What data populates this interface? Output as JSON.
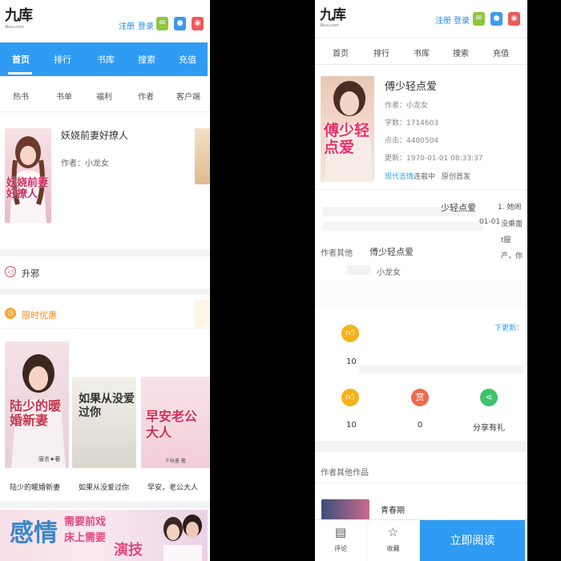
{
  "left": {
    "logo_main": "九库",
    "logo_sub": "9kus.com",
    "header_links": {
      "register": "注册",
      "login": "登录"
    },
    "nav": [
      "首页",
      "排行",
      "书库",
      "搜索",
      "充值"
    ],
    "subnav": [
      "热书",
      "书单",
      "福利",
      "作者",
      "客户端"
    ],
    "featured_book": {
      "title": "妖娆前妻好撩人",
      "author": "作者：小龙女",
      "cover_text": "妖娆前妻好撩人"
    },
    "section_rank": {
      "label": "升邪",
      "icon": "speaker-icon"
    },
    "section_sale": {
      "label": "限时优惠",
      "icon": "clock-icon"
    },
    "books": [
      {
        "title": "陆少的暖婚新妻",
        "cover_text": "陆少的暖婚新妻",
        "cover_author": "唐衣★著"
      },
      {
        "title": "如果从没爱过你",
        "cover_text": "如果从没爱过你"
      },
      {
        "title": "早安，老公大人",
        "cover_text": "早安老公大人",
        "cover_author": "千秋墨 著"
      }
    ],
    "banner": {
      "big_text": "感情",
      "line1": "需要前戏",
      "line2": "床上需要",
      "line3": "演技"
    }
  },
  "right": {
    "logo_main": "九库",
    "logo_sub": "9kus.com",
    "header_links": {
      "register": "注册",
      "login": "登录"
    },
    "nav": [
      "首页",
      "排行",
      "书库",
      "搜索",
      "充值"
    ],
    "book": {
      "title": "傅少轻点爱",
      "cover_text": "傅少轻点爱",
      "author": "作者：小龙女",
      "word_count": "字数：1714603",
      "clicks": "点击：4480504",
      "updated": "更新：1970-01-01 08:33:37",
      "tag_category": "现代言情",
      "tag_status": "连载中",
      "tag_original": "原创首发"
    },
    "fragments": {
      "a": "少轻点爱",
      "b": "1. 她闹",
      "c": "01-01",
      "d": "没乘面",
      "e": "t服",
      "f": "产，你"
    },
    "author_line": "作者其他",
    "other_title": "傅少轻点爱",
    "author_line2": "小龙女",
    "update_link": "下更新：",
    "like_top": {
      "count": "10"
    },
    "actions": [
      {
        "icon": "thumb-up-icon",
        "value": "10",
        "color": "#f5b31a"
      },
      {
        "icon": "reward-icon",
        "value": "0",
        "color": "#f06b4b",
        "glyph": "赏"
      },
      {
        "icon": "share-icon",
        "value": "分享有礼",
        "color": "#3ec36b"
      }
    ],
    "other_works_heading": "作者其他作品",
    "other_work_title": "青春期",
    "bottom": {
      "comment": "评论",
      "collect": "收藏",
      "read": "立即阅读"
    }
  }
}
